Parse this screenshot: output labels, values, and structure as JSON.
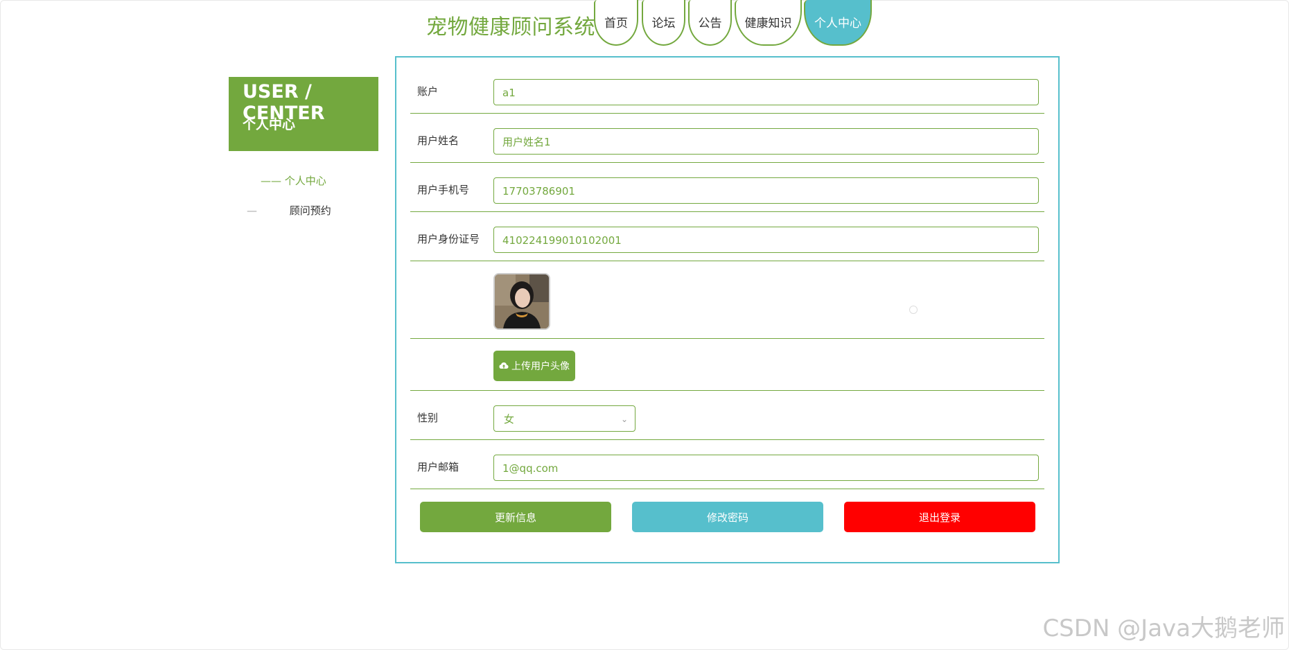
{
  "site": {
    "title": "宠物健康顾问系统"
  },
  "nav": {
    "tabs": [
      {
        "label": "首页"
      },
      {
        "label": "论坛"
      },
      {
        "label": "公告"
      },
      {
        "label": "健康知识"
      },
      {
        "label": "个人中心",
        "active": true
      }
    ]
  },
  "sidebar": {
    "title_en": "USER / CENTER",
    "title_cn": "个人中心",
    "items": [
      {
        "dash": "——",
        "label": "个人中心",
        "active": true
      },
      {
        "dash": "—",
        "label": "顾问预约",
        "active": false
      }
    ]
  },
  "form": {
    "account": {
      "label": "账户",
      "value": "a1"
    },
    "name": {
      "label": "用户姓名",
      "value": "用户姓名1"
    },
    "phone": {
      "label": "用户手机号",
      "value": "17703786901"
    },
    "idcard": {
      "label": "用户身份证号",
      "value": "410224199010102001"
    },
    "upload_label": "上传用户头像",
    "gender": {
      "label": "性别",
      "value": "女"
    },
    "email": {
      "label": "用户邮箱",
      "value": "1@qq.com"
    }
  },
  "actions": {
    "update": "更新信息",
    "change_password": "修改密码",
    "logout": "退出登录"
  },
  "watermark": "CSDN @Java大鹅老师",
  "colors": {
    "primary": "#73a83e",
    "accent": "#56bfcc",
    "danger": "#ff0000"
  }
}
